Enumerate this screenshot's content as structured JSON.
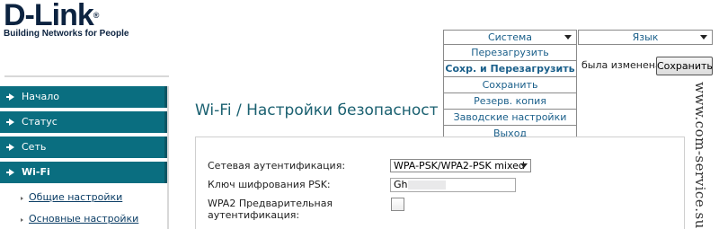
{
  "logo": {
    "name": "D-Link",
    "reg_mark": "®",
    "tagline": "Building Networks for People"
  },
  "top_bar": {
    "system_select": {
      "label": "Система"
    },
    "language_select": {
      "label": "Язык"
    }
  },
  "system_menu": {
    "items": [
      {
        "label": "Перезагрузить"
      },
      {
        "label": "Сохр. и Перезагрузить"
      },
      {
        "label": "Сохранить"
      },
      {
        "label": "Резерв. копия"
      },
      {
        "label": "Заводские настройки"
      },
      {
        "label": "Выход"
      }
    ],
    "highlighted_index": 1
  },
  "notification": {
    "text": "была изменена"
  },
  "save_button": {
    "label": "Сохранить"
  },
  "sidebar": {
    "items": [
      {
        "label": "Начало"
      },
      {
        "label": "Статус"
      },
      {
        "label": "Сеть"
      },
      {
        "label": "Wi-Fi",
        "current": true
      }
    ],
    "sub_items": [
      {
        "label": "Общие настройки"
      },
      {
        "label": "Основные настройки"
      }
    ]
  },
  "page_title": "Wi-Fi  /  Настройки безопасност",
  "form": {
    "auth_label": "Сетевая аутентификация:",
    "auth_value": "WPA-PSK/WPA2-PSK mixed",
    "psk_label": "Ключ шифрования PSK:",
    "psk_value": "Gh",
    "wpa2_label_line1": "WPA2 Предварительная",
    "wpa2_label_line2": "аутентификация:",
    "wpa2_checked": false
  },
  "watermark": "www.com-service.su",
  "colors": {
    "nav_bg": "#0a6e80",
    "title": "#1a6070",
    "menu_text": "#1a5f8a",
    "logo": "#0c2340"
  }
}
